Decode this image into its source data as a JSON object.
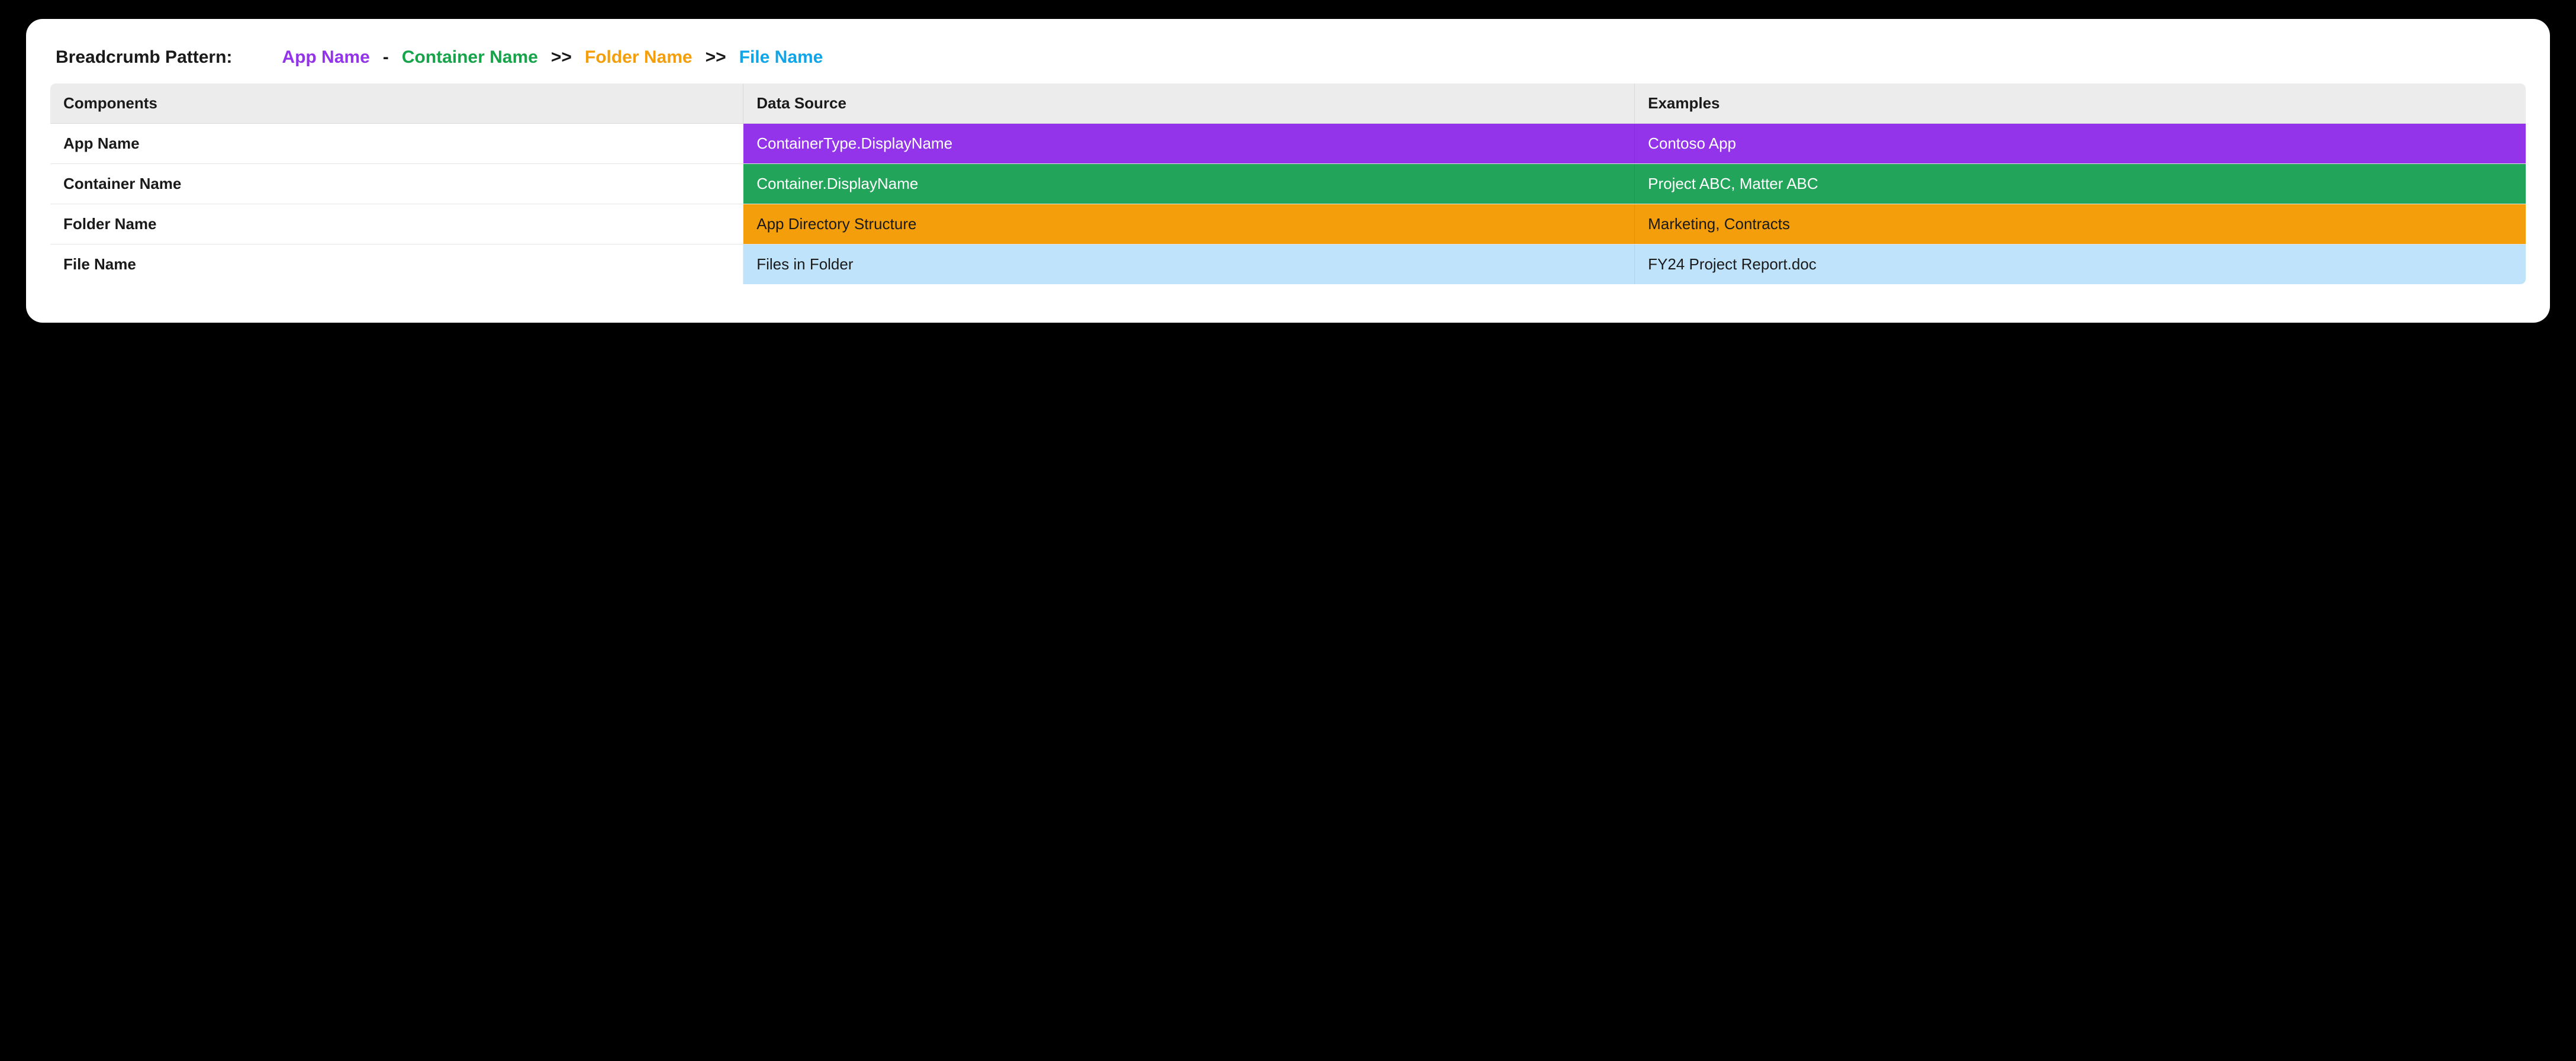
{
  "pattern": {
    "label": "Breadcrumb Pattern:",
    "segments": {
      "app": "App Name",
      "container": "Container Name",
      "folder": "Folder Name",
      "file": "File Name"
    },
    "separators": {
      "dash": "-",
      "chevron": ">>"
    }
  },
  "table": {
    "headers": {
      "components": "Components",
      "data_source": "Data Source",
      "examples": "Examples"
    },
    "rows": [
      {
        "key": "app",
        "component": "App Name",
        "data_source": "ContainerType.DisplayName",
        "example": "Contoso App"
      },
      {
        "key": "container",
        "component": "Container Name",
        "data_source": "Container.DisplayName",
        "example": "Project ABC, Matter ABC"
      },
      {
        "key": "folder",
        "component": "Folder Name",
        "data_source": "App Directory Structure",
        "example": "Marketing, Contracts"
      },
      {
        "key": "file",
        "component": "File Name",
        "data_source": "Files in Folder",
        "example": "FY24 Project Report.doc"
      }
    ]
  },
  "colors": {
    "app": "#9333ea",
    "container": "#22a55a",
    "folder": "#f59e0b",
    "file_bg": "#bfe3fb",
    "file_text": "#0ea5e9"
  }
}
